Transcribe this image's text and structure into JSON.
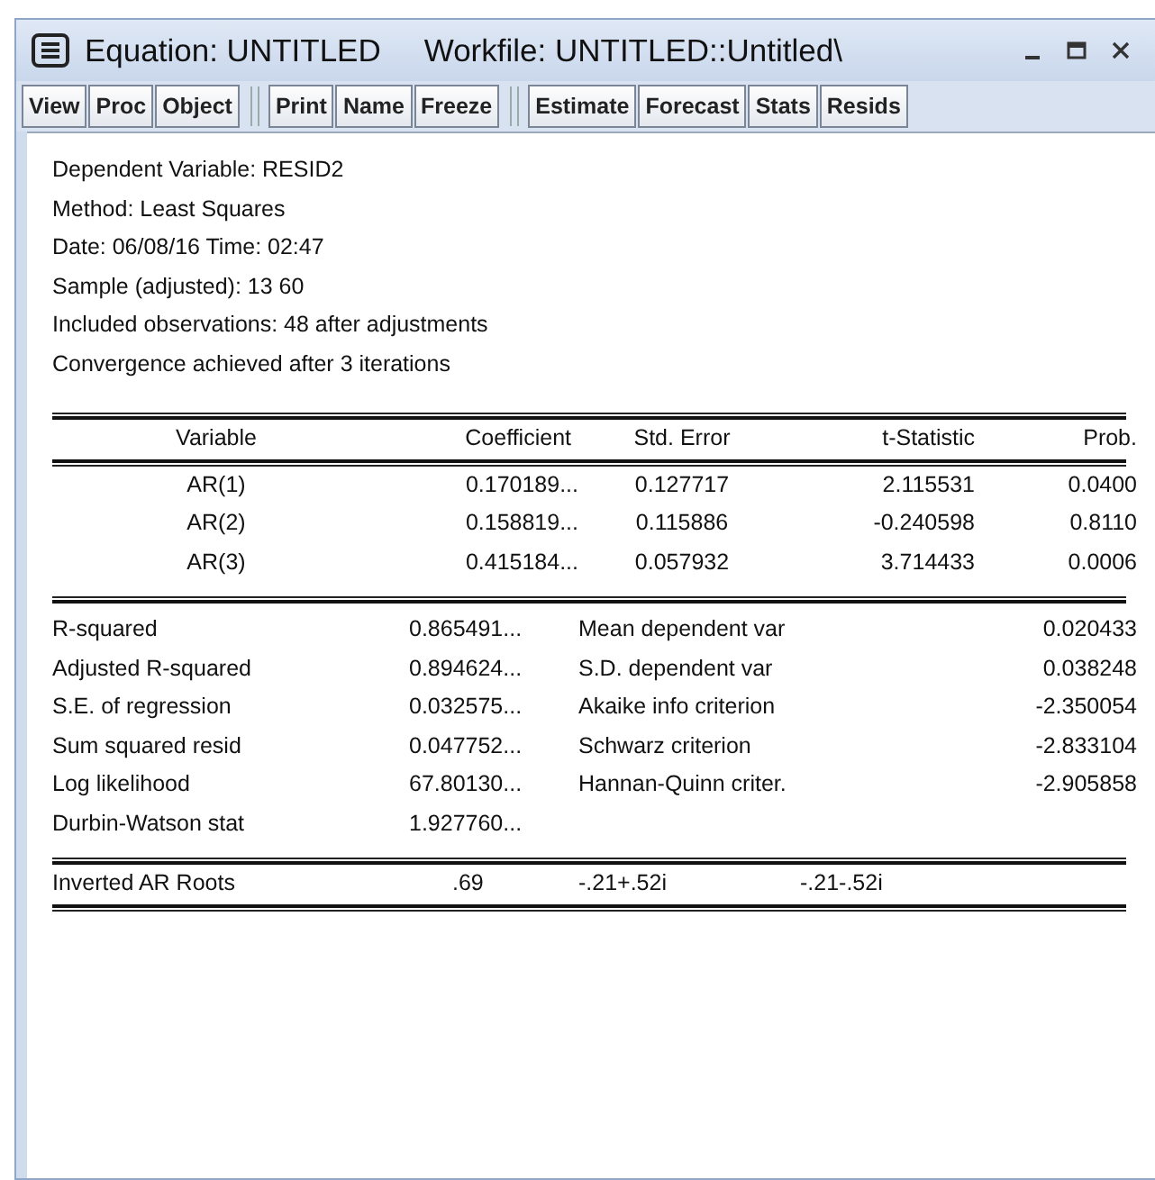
{
  "window": {
    "title": "Equation: UNTITLED",
    "workfile": "Workfile: UNTITLED::Untitled\\"
  },
  "toolbar": [
    [
      "View",
      "Proc",
      "Object"
    ],
    [
      "Print",
      "Name",
      "Freeze"
    ],
    [
      "Estimate",
      "Forecast",
      "Stats",
      "Resids"
    ]
  ],
  "header_lines": [
    "Dependent Variable: RESID2",
    "Method: Least Squares",
    "Date: 06/08/16   Time: 02:47",
    "Sample (adjusted): 13 60",
    "Included observations: 48 after adjustments",
    "Convergence achieved after 3 iterations"
  ],
  "table": {
    "columns": [
      "Variable",
      "Coefficient",
      "Std. Error",
      "t-Statistic",
      "Prob."
    ],
    "rows": [
      [
        "AR(1)",
        "0.170189...",
        "0.127717",
        "2.115531",
        "0.0400"
      ],
      [
        "AR(2)",
        "0.158819...",
        "0.115886",
        "-0.240598",
        "0.8110"
      ],
      [
        "AR(3)",
        "0.415184...",
        "0.057932",
        "3.714433",
        "0.0006"
      ]
    ]
  },
  "statistics": [
    [
      "R-squared",
      "0.865491...",
      "Mean dependent var",
      "0.020433"
    ],
    [
      "Adjusted R-squared",
      "0.894624...",
      "S.D. dependent var",
      "0.038248"
    ],
    [
      "S.E. of regression",
      "0.032575...",
      "Akaike info criterion",
      "-2.350054"
    ],
    [
      "Sum squared resid",
      "0.047752...",
      "Schwarz criterion",
      "-2.833104"
    ],
    [
      "Log likelihood",
      "67.80130...",
      "Hannan-Quinn criter.",
      "-2.905858"
    ],
    [
      "Durbin-Watson stat",
      "1.927760..."
    ]
  ],
  "inverted_ar_roots": {
    "label": "Inverted AR Roots",
    "values": [
      ".69",
      "-.21+.52i",
      "-.21-.52i"
    ]
  }
}
